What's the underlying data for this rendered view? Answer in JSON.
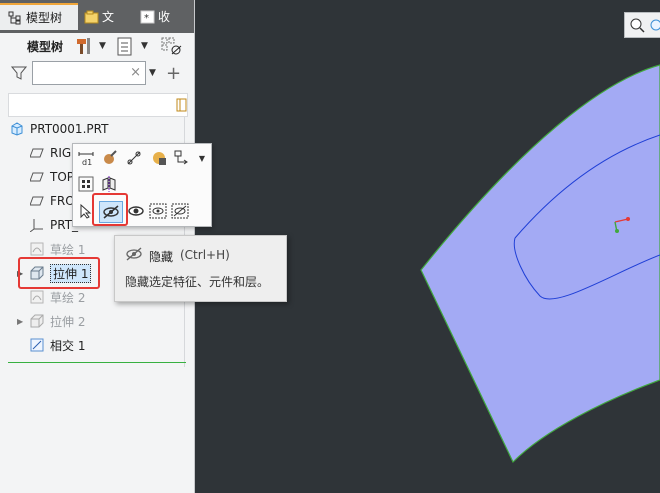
{
  "tabs": [
    {
      "label": "模型树",
      "icon": "model-tree-icon"
    },
    {
      "label": "文",
      "icon": "folder-icon"
    },
    {
      "label": "收",
      "icon": "favorites-icon"
    }
  ],
  "toolbar": {
    "label": "模型树",
    "icons": [
      "hammer-icon",
      "settings-icon",
      "chevron-down-icon",
      "tree-settings-icon",
      "chevron-down-icon",
      "columns-icon"
    ]
  },
  "search": {
    "value": "",
    "clear": "×"
  },
  "tree": {
    "root": "PRT0001.PRT",
    "items": [
      {
        "label": "RIG",
        "icon": "plane-icon",
        "dim": false
      },
      {
        "label": "TOP",
        "icon": "plane-icon",
        "dim": false
      },
      {
        "label": "FRO",
        "icon": "plane-icon",
        "dim": false
      },
      {
        "label": "PRT_",
        "icon": "csys-icon",
        "dim": false
      },
      {
        "label": "草绘 1",
        "icon": "sketch-icon",
        "dim": true
      },
      {
        "label": "拉伸 1",
        "icon": "extrude-icon",
        "dim": false,
        "selected": true
      },
      {
        "label": "草绘 2",
        "icon": "sketch-icon",
        "dim": true
      },
      {
        "label": "拉伸 2",
        "icon": "extrude-icon",
        "dim": true
      },
      {
        "label": "相交 1",
        "icon": "intersect-icon",
        "dim": false
      }
    ]
  },
  "tooltip": {
    "title": "隐藏",
    "shortcut": "(Ctrl+H)",
    "description": "隐藏选定特征、元件和层。"
  },
  "colors": {
    "surface": "#a3aaf4",
    "edge": "#41a83e",
    "curve": "#1f3fd6",
    "accent": "#e53935"
  }
}
